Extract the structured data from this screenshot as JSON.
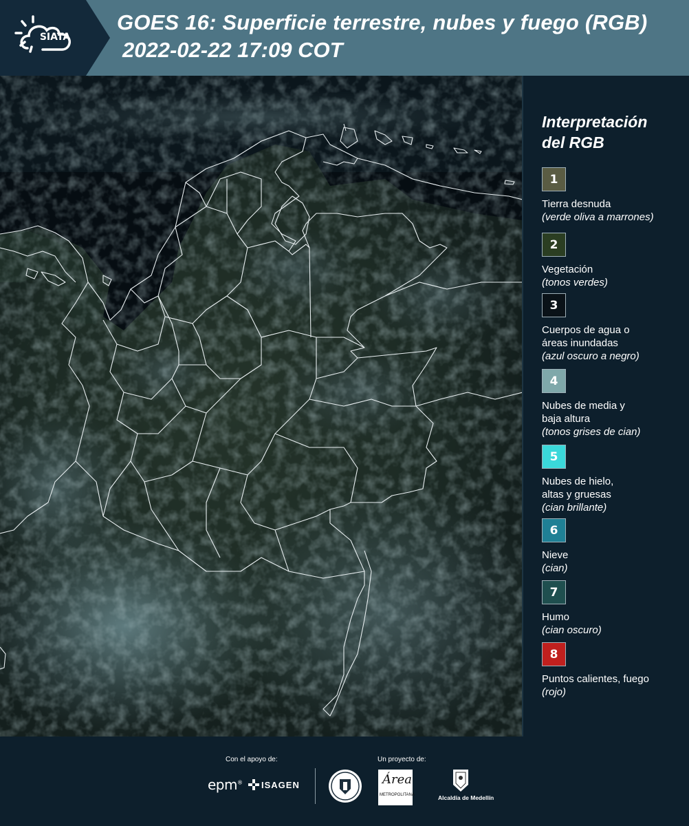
{
  "header": {
    "logo_text": "SIATA",
    "title": "GOES 16: Superficie terrestre, nubes y fuego (RGB)",
    "datetime": "2022-02-22 17:09 COT"
  },
  "legend": {
    "title_line1": "Interpretación",
    "title_line2": "del RGB",
    "items": [
      {
        "number": "1",
        "color": "#5a5c43",
        "label_lines": [
          "Tierra desnuda"
        ],
        "note": "(verde oliva a marrones)"
      },
      {
        "number": "2",
        "color": "#2b3e22",
        "label_lines": [
          "Vegetación"
        ],
        "note": "(tonos verdes)"
      },
      {
        "number": "3",
        "color": "#0a1218",
        "label_lines": [
          "Cuerpos de agua o",
          "áreas inundadas"
        ],
        "note": "(azul oscuro a negro)"
      },
      {
        "number": "4",
        "color": "#7fa8aa",
        "label_lines": [
          "Nubes de media y",
          "baja altura"
        ],
        "note": "(tonos grises de cian)"
      },
      {
        "number": "5",
        "color": "#3ad8da",
        "label_lines": [
          "Nubes de hielo,",
          "altas y gruesas"
        ],
        "note": "(cian brillante)"
      },
      {
        "number": "6",
        "color": "#1f8095",
        "label_lines": [
          "Nieve"
        ],
        "note": "(cian)"
      },
      {
        "number": "7",
        "color": "#1f4f4f",
        "label_lines": [
          "Humo"
        ],
        "note": "(cian oscuro)"
      },
      {
        "number": "8",
        "color": "#c0201e",
        "label_lines": [
          "Puntos calientes, fuego"
        ],
        "note": "(rojo)"
      }
    ]
  },
  "footer": {
    "support_caption": "Con el apoyo de:",
    "project_caption": "Un proyecto de:",
    "sponsor_logos": [
      "epm",
      "ISAGEN"
    ],
    "partner_logos": [
      "Área Metropolitana",
      "Alcaldía de Medellín"
    ],
    "medellin_text": "Alcaldía de Medellín"
  },
  "colors": {
    "header_bg": "#4e7585",
    "logo_bg": "#13293a",
    "page_bg": "#0d1f2c",
    "border_lines": "#e8eef0"
  }
}
